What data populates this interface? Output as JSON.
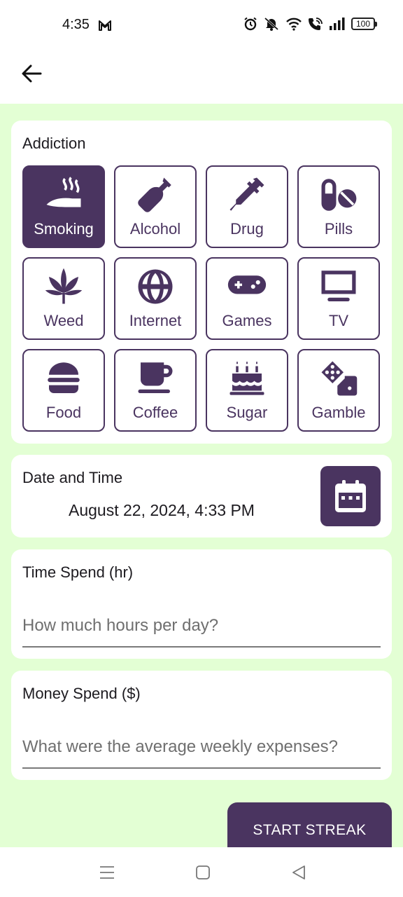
{
  "status_bar": {
    "time": "4:35",
    "battery": "100",
    "icons": [
      "gmail-icon",
      "alarm-icon",
      "mute-icon",
      "wifi-icon",
      "wifi-call-icon",
      "signal-icon",
      "battery-icon"
    ]
  },
  "app_bar": {
    "back_icon": "arrow-left-icon"
  },
  "addiction": {
    "label": "Addiction",
    "selected": "Smoking",
    "items": [
      {
        "label": "Smoking",
        "icon": "smoking-icon"
      },
      {
        "label": "Alcohol",
        "icon": "bottle-icon"
      },
      {
        "label": "Drug",
        "icon": "syringe-icon"
      },
      {
        "label": "Pills",
        "icon": "pills-icon"
      },
      {
        "label": "Weed",
        "icon": "cannabis-leaf-icon"
      },
      {
        "label": "Internet",
        "icon": "globe-icon"
      },
      {
        "label": "Games",
        "icon": "gamepad-icon"
      },
      {
        "label": "TV",
        "icon": "tv-icon"
      },
      {
        "label": "Food",
        "icon": "burger-icon"
      },
      {
        "label": "Coffee",
        "icon": "mug-icon"
      },
      {
        "label": "Sugar",
        "icon": "cake-icon"
      },
      {
        "label": "Gamble",
        "icon": "dice-icon"
      }
    ]
  },
  "date_time": {
    "label": "Date and Time",
    "value": "August 22, 2024, 4:33 PM",
    "button_icon": "calendar-icon"
  },
  "time_spend": {
    "label": "Time Spend (hr)",
    "placeholder": "How much hours per day?",
    "value": ""
  },
  "money_spend": {
    "label": "Money Spend ($)",
    "placeholder": "What were the average weekly expenses?",
    "value": ""
  },
  "start_button": {
    "label": "START STREAK"
  },
  "nav_bar": {
    "items": [
      "menu-icon",
      "home-icon",
      "back-icon"
    ]
  },
  "colors": {
    "accent": "#4a3460",
    "background": "#e3ffd4",
    "card": "#ffffff"
  }
}
